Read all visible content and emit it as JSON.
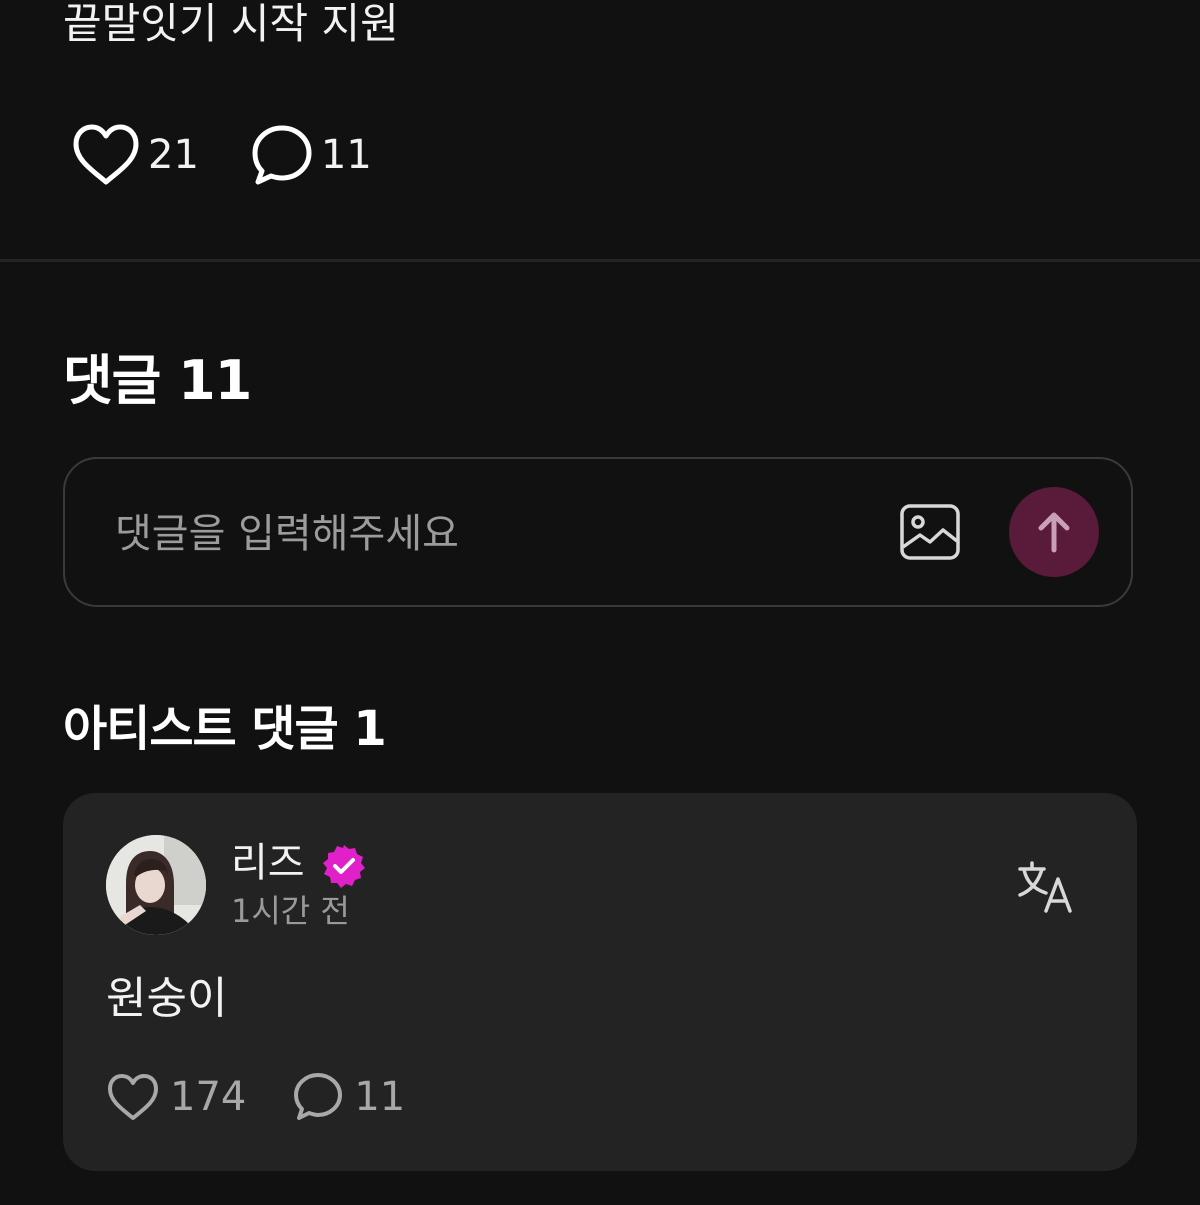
{
  "post": {
    "text": "끝말잇기 시작 지원",
    "like_count": "21",
    "comment_count": "11"
  },
  "comments_section": {
    "title": "댓글 11",
    "input_placeholder": "댓글을 입력해주세요"
  },
  "artist_comments": {
    "title": "아티스트 댓글 1",
    "items": [
      {
        "author": "리즈",
        "verified": true,
        "time": "1시간 전",
        "body": "원숭이",
        "like_count": "174",
        "reply_count": "11"
      }
    ]
  },
  "colors": {
    "background": "#111111",
    "card": "#232323",
    "send_button": "#5a1a3a",
    "verified_badge": "#e020c8"
  }
}
